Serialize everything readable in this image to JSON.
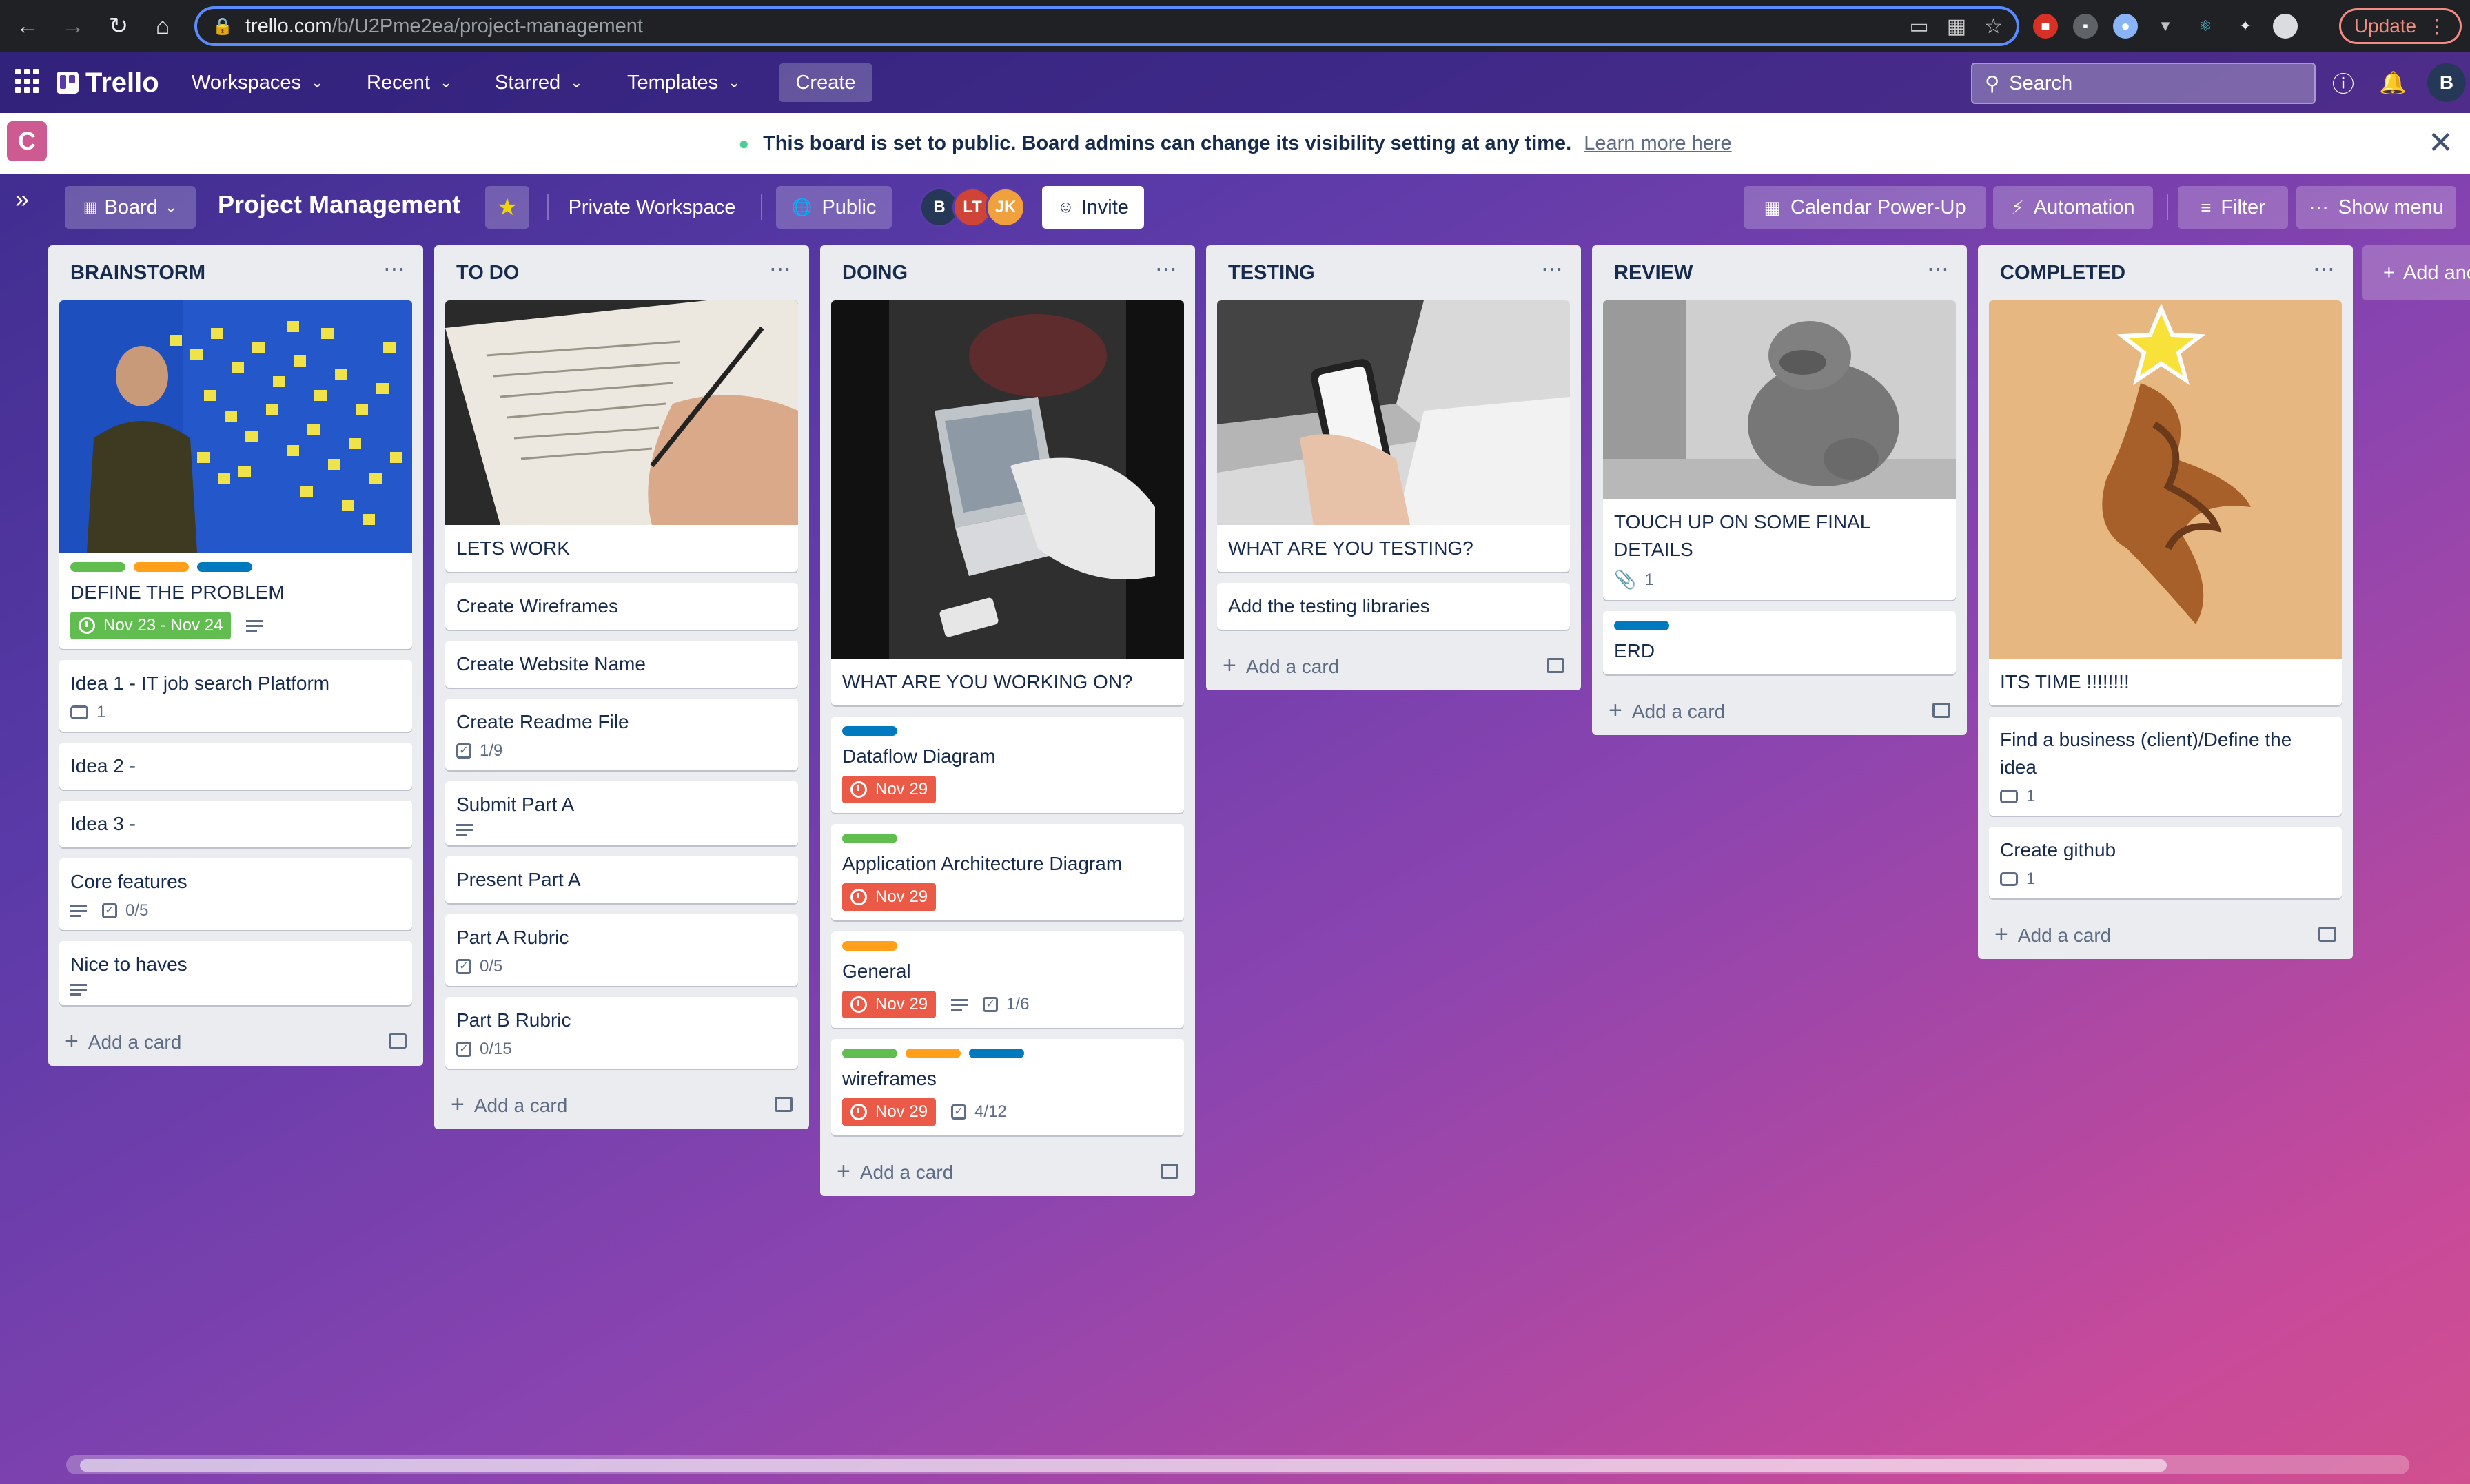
{
  "browser": {
    "url_host": "trello.com",
    "url_path": "/b/U2Pme2ea/project-management",
    "update_label": "Update"
  },
  "header": {
    "logo": "Trello",
    "nav": [
      "Workspaces",
      "Recent",
      "Starred",
      "Templates"
    ],
    "create_label": "Create",
    "search_placeholder": "Search",
    "avatar": "B"
  },
  "banner": {
    "message": "This board is set to public. Board admins can change its visibility setting at any time.",
    "link": "Learn more here"
  },
  "workspace_badge": "C",
  "board": {
    "view_label": "Board",
    "title": "Project Management",
    "workspace_label": "Private Workspace",
    "visibility_label": "Public",
    "members": [
      {
        "initials": "B",
        "color": "#253858"
      },
      {
        "initials": "LT",
        "color": "#d04437"
      },
      {
        "initials": "JK",
        "color": "#f0a03c"
      }
    ],
    "invite_label": "Invite",
    "calendar_label": "Calendar Power-Up",
    "automation_label": "Automation",
    "filter_label": "Filter",
    "menu_label": "Show menu",
    "add_list_label": "Add another list"
  },
  "colors": {
    "label_green": "#61bd4f",
    "label_orange": "#ff9f1a",
    "label_blue": "#0079bf",
    "due_red": "#eb5a46",
    "due_green": "#61bd4f"
  },
  "lists": {
    "brainstorm": {
      "title": "BRAINSTORM",
      "add_card": "Add a card",
      "cards": {
        "c0": {
          "title": "DEFINE THE PROBLEM",
          "due": "Nov 23 - Nov 24"
        },
        "c1": {
          "title": "Idea 1 - IT job search Platform",
          "comments": "1"
        },
        "c2": {
          "title": "Idea 2 -"
        },
        "c3": {
          "title": "Idea 3 -"
        },
        "c4": {
          "title": "Core features",
          "checklist": "0/5"
        },
        "c5": {
          "title": "Nice to haves"
        }
      }
    },
    "todo": {
      "title": "TO DO",
      "add_card": "Add a card",
      "cards": {
        "c0": {
          "title": "LETS WORK"
        },
        "c1": {
          "title": "Create Wireframes"
        },
        "c2": {
          "title": "Create Website Name"
        },
        "c3": {
          "title": "Create Readme File",
          "checklist": "1/9"
        },
        "c4": {
          "title": "Submit Part A"
        },
        "c5": {
          "title": "Present Part A"
        },
        "c6": {
          "title": "Part A Rubric",
          "checklist": "0/5"
        },
        "c7": {
          "title": "Part B Rubric",
          "checklist": "0/15"
        }
      }
    },
    "doing": {
      "title": "DOING",
      "add_card": "Add a card",
      "cards": {
        "c0": {
          "title": "WHAT ARE YOU WORKING ON?"
        },
        "c1": {
          "title": "Dataflow Diagram",
          "due": "Nov 29"
        },
        "c2": {
          "title": "Application Architecture Diagram",
          "due": "Nov 29"
        },
        "c3": {
          "title": "General",
          "due": "Nov 29",
          "checklist": "1/6"
        },
        "c4": {
          "title": "wireframes",
          "due": "Nov 29",
          "checklist": "4/12"
        }
      }
    },
    "testing": {
      "title": "TESTING",
      "add_card": "Add a card",
      "cards": {
        "c0": {
          "title": "WHAT ARE YOU TESTING?"
        },
        "c1": {
          "title": "Add the testing libraries"
        }
      }
    },
    "review": {
      "title": "REVIEW",
      "add_card": "Add a card",
      "cards": {
        "c0": {
          "title": "TOUCH UP ON SOME FINAL DETAILS",
          "attachments": "1"
        },
        "c1": {
          "title": "ERD"
        }
      }
    },
    "completed": {
      "title": "COMPLETED",
      "add_card": "Add a card",
      "cards": {
        "c0": {
          "title": "ITS TIME !!!!!!!!"
        },
        "c1": {
          "title": "Find a business (client)/Define the idea",
          "comments": "1"
        },
        "c2": {
          "title": "Create github",
          "comments": "1"
        }
      }
    }
  }
}
